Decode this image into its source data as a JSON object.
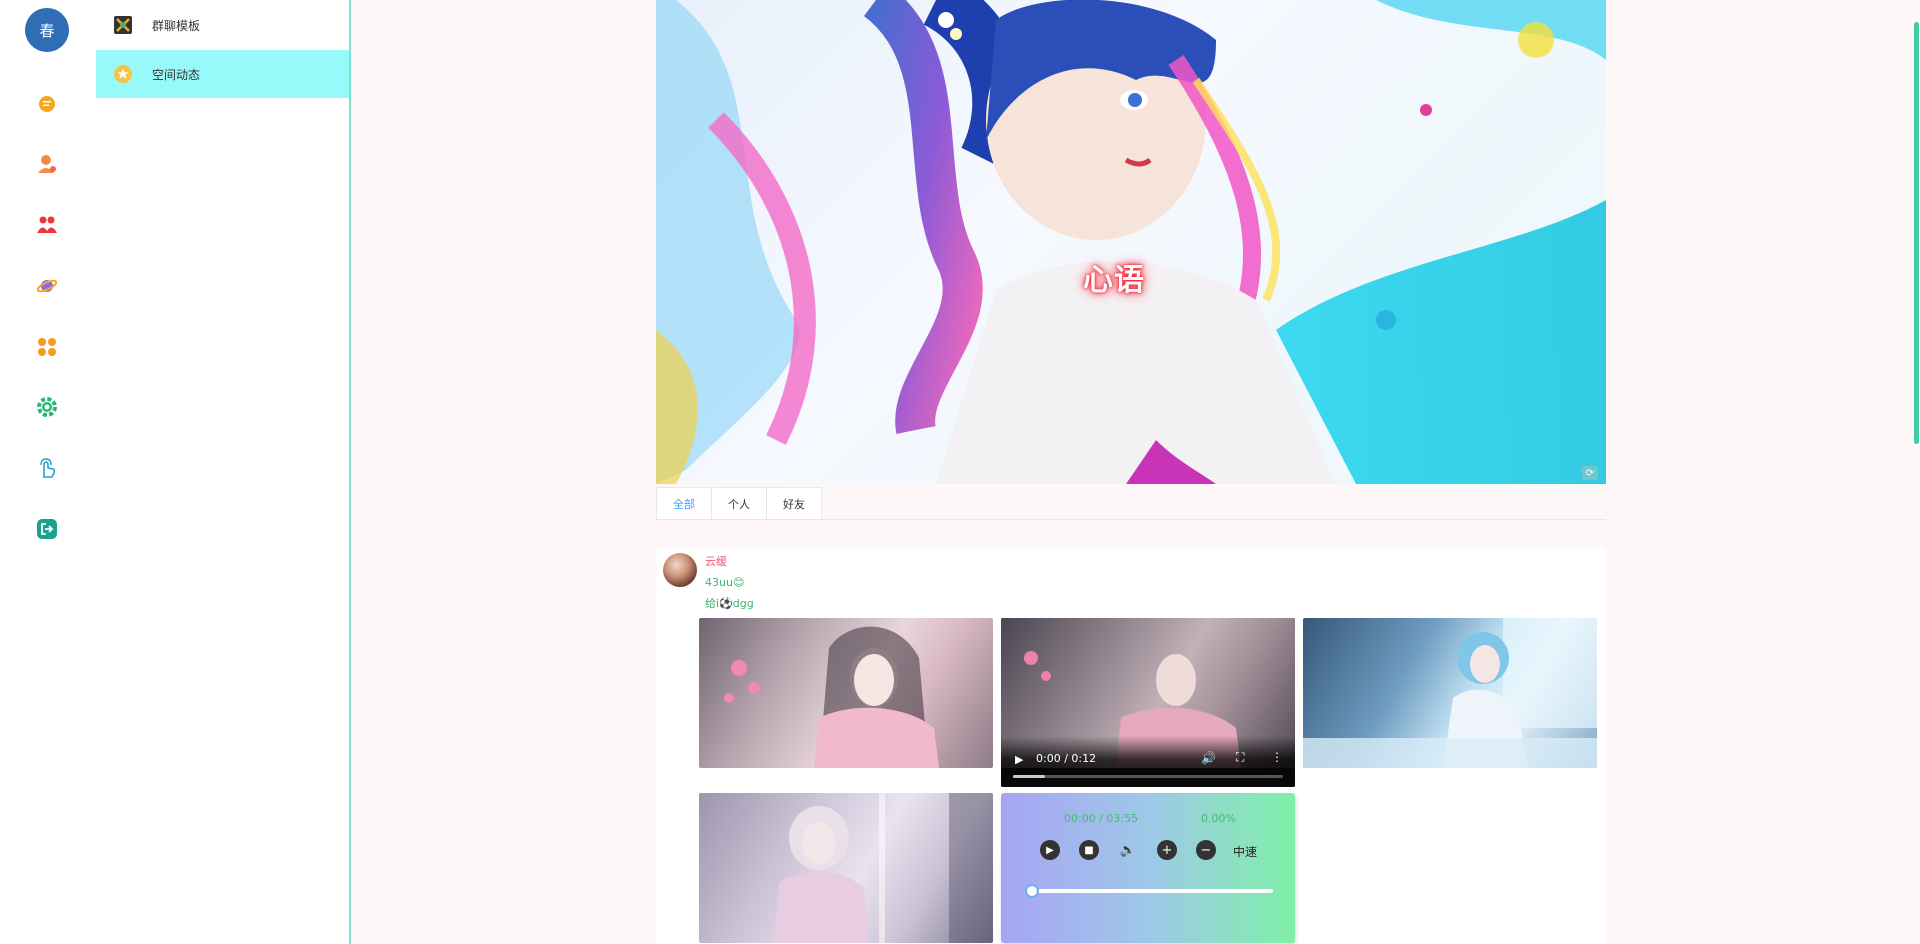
{
  "rail": {
    "avatar_text": "春",
    "icons": [
      "chat-icon",
      "contact-icon",
      "group-icon",
      "planet-icon",
      "apps-icon",
      "settings-icon",
      "gesture-icon",
      "logout-icon"
    ]
  },
  "submenu": {
    "items": [
      {
        "label": "群聊模板",
        "icon": "template-icon"
      },
      {
        "label": "空间动态",
        "icon": "star-icon"
      }
    ]
  },
  "banner": {
    "title": "心语"
  },
  "tabs": [
    {
      "label": "全部"
    },
    {
      "label": "个人"
    },
    {
      "label": "好友"
    }
  ],
  "post": {
    "user": "云缓",
    "line1": "43uu😊",
    "line2": "给i⚽dgg"
  },
  "video": {
    "time": "0:00 / 0:12"
  },
  "audio": {
    "time": "00:00 / 03:55",
    "progress": "0.00%",
    "speed": "中速"
  },
  "colors": {
    "accent": "#409eff",
    "submenu_active": "#98f9fb",
    "username": "#ef5b7a",
    "post_text": "#3cb371"
  }
}
